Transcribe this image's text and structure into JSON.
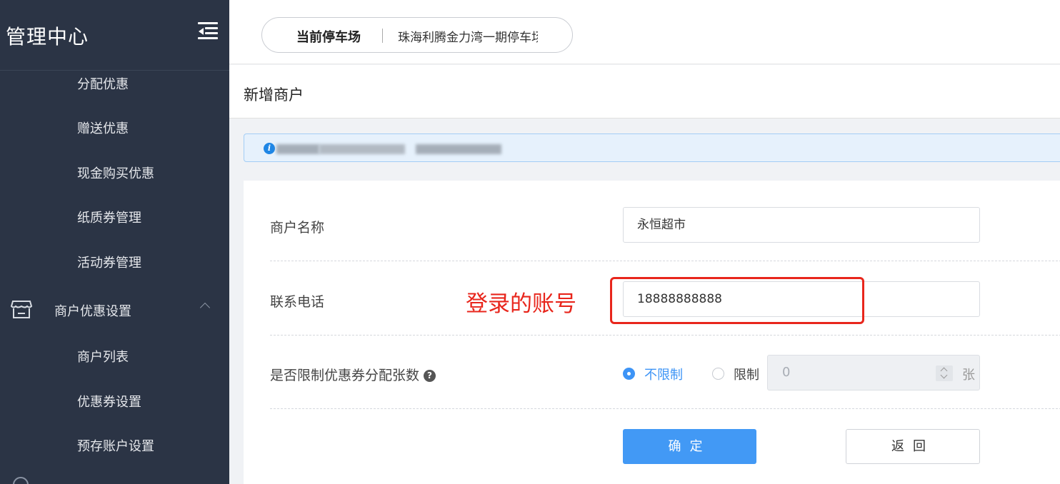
{
  "sidebar": {
    "brand": "管理中心",
    "items": [
      {
        "label": "分配优惠"
      },
      {
        "label": "赠送优惠"
      },
      {
        "label": "现金购买优惠"
      },
      {
        "label": "纸质券管理"
      },
      {
        "label": "活动券管理"
      }
    ],
    "group": {
      "label": "商户优惠设置",
      "icon": "store-icon",
      "expanded": true
    },
    "sub_items": [
      {
        "label": "商户列表"
      },
      {
        "label": "优惠券设置"
      },
      {
        "label": "预存账户设置"
      }
    ]
  },
  "header": {
    "lot_label": "当前停车场",
    "lot_value": "珠海利腾金力湾一期停车场"
  },
  "page": {
    "title": "新增商户"
  },
  "alert": {
    "icon": "info-icon",
    "text": "",
    "accent": "#1f86e5"
  },
  "form": {
    "name_label": "商户名称",
    "name_value": "永恒超市",
    "phone_label": "联系电话",
    "phone_value": "18888888888",
    "limit_label": "是否限制优惠券分配张数",
    "help_icon": "?",
    "radio_unlimited": "不限制",
    "radio_limited": "限制",
    "selected": "不限制",
    "count_value": "0",
    "count_unit": "张",
    "confirm_label": "确定",
    "back_label": "返回"
  },
  "annotation": {
    "text": "登录的账号",
    "color": "#e8261c"
  },
  "colors": {
    "sidebar_bg": "#2b3445",
    "primary": "#4299f5"
  }
}
